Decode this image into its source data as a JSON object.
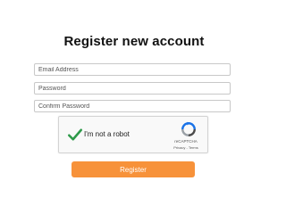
{
  "form": {
    "title": "Register new account",
    "fields": [
      {
        "placeholder": "Email Address",
        "value": ""
      },
      {
        "placeholder": "Password",
        "value": ""
      },
      {
        "placeholder": "Confirm Password",
        "value": ""
      }
    ],
    "register_label": "Register"
  },
  "captcha": {
    "label": "I'm not a robot",
    "checked": true,
    "brand": "reCAPTCHA",
    "privacy_label": "Privacy",
    "separator": " - ",
    "terms_label": "Terms",
    "check_icon": "checkmark-icon",
    "logo_icon": "recaptcha-logo-icon"
  },
  "colors": {
    "accent": "#f7923a",
    "check": "#2e9a4a",
    "recaptcha_blue": "#1a73e8"
  }
}
